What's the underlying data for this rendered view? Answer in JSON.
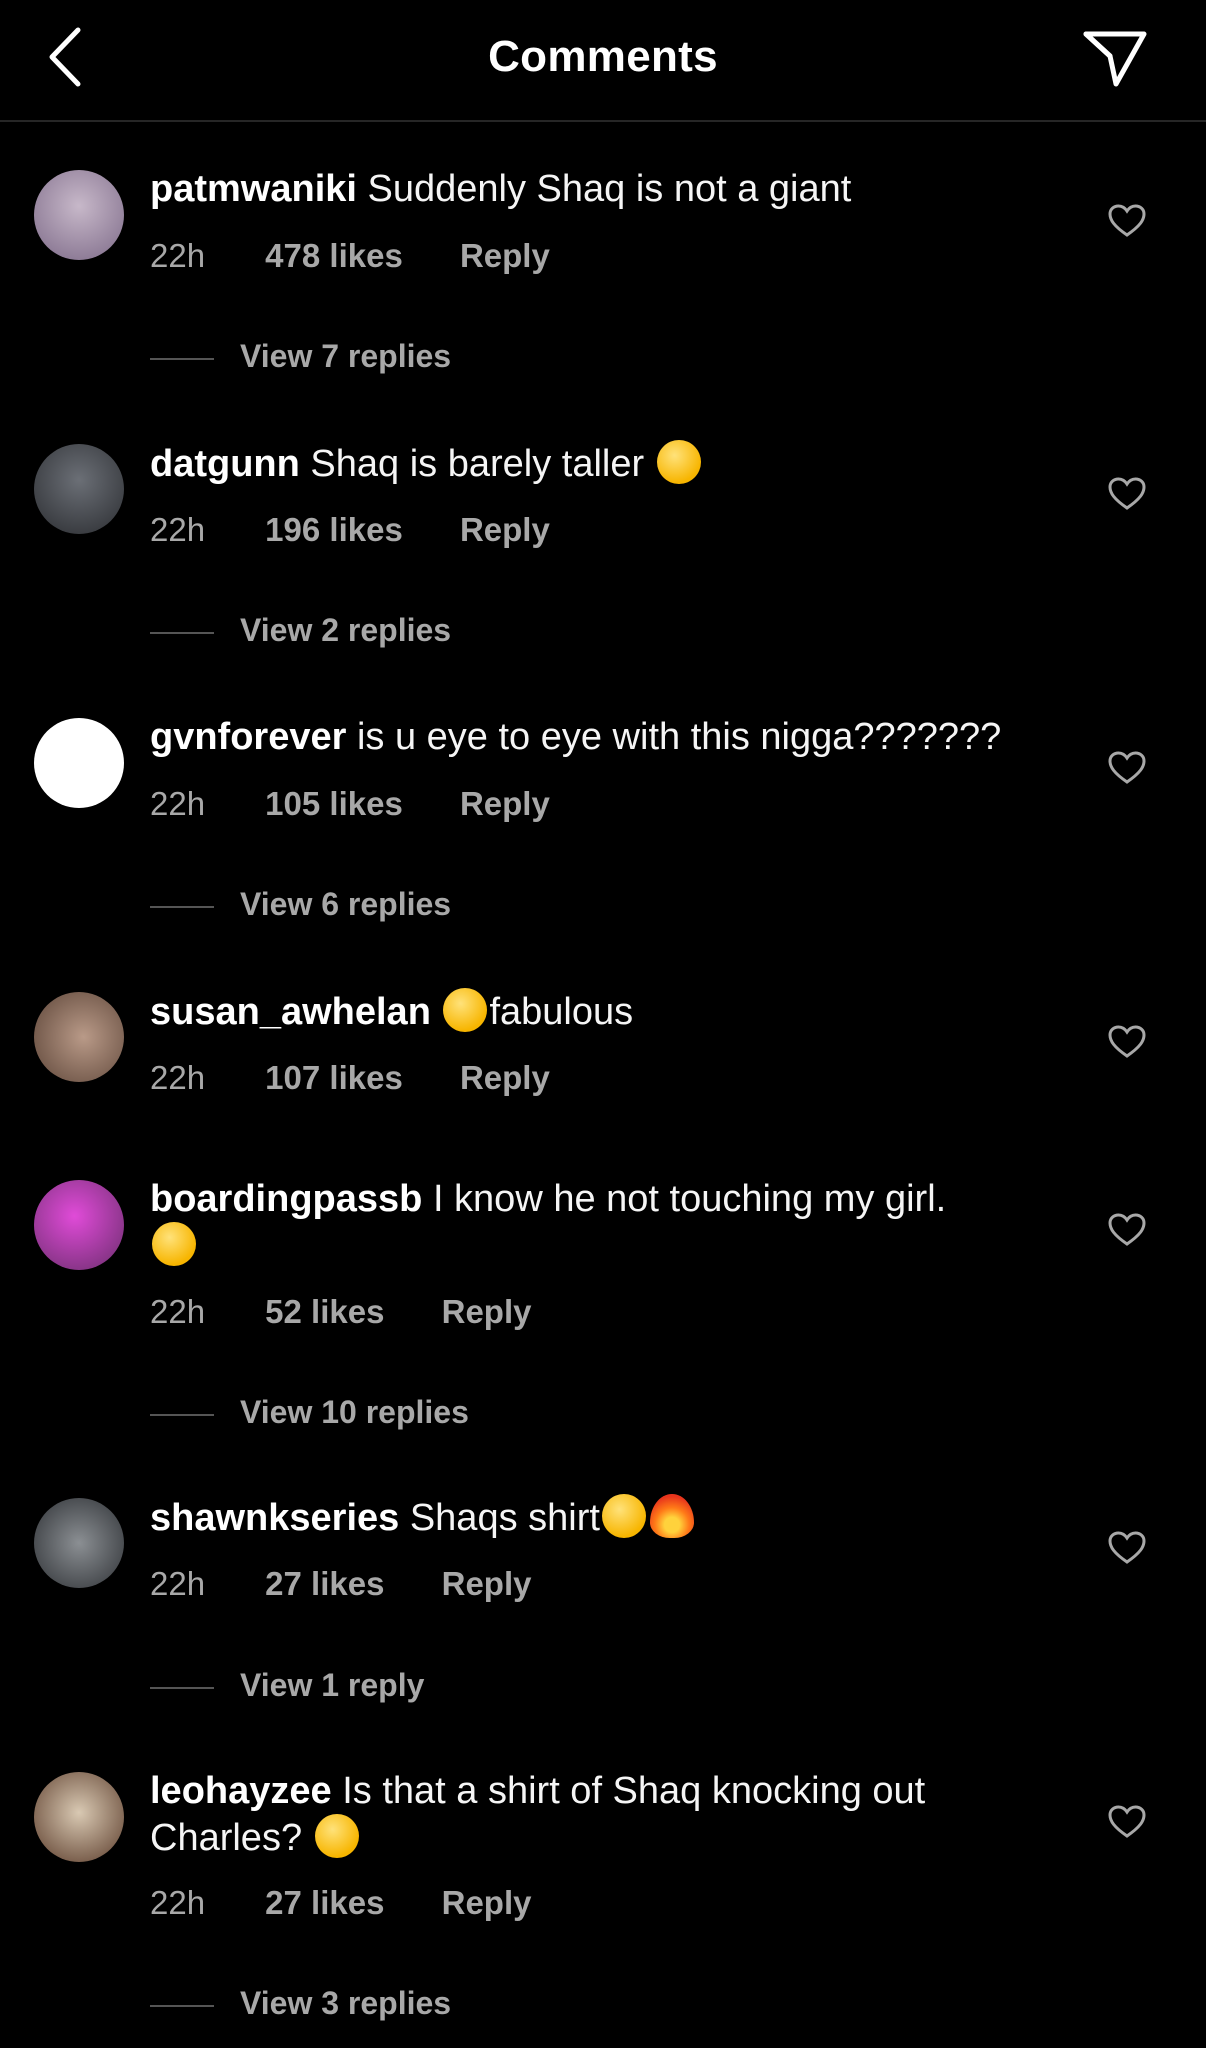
{
  "header": {
    "title": "Comments"
  },
  "comments": [
    {
      "username": "patmwaniki",
      "text": "Suddenly Shaq is not a giant",
      "emoji": [],
      "time": "22h",
      "likes": "478 likes",
      "reply": "Reply",
      "view_replies": "View 7 replies",
      "avatar_colors": [
        "#c7b8c9",
        "#7d6a88"
      ]
    },
    {
      "username": "datgunn",
      "text": "Shaq is barely taller",
      "emoji": [
        "astonished-face"
      ],
      "time": "22h",
      "likes": "196 likes",
      "reply": "Reply",
      "view_replies": "View 2 replies",
      "avatar_colors": [
        "#6b6f76",
        "#2b2d31"
      ]
    },
    {
      "username": "gvnforever",
      "text": "is u eye to eye with this nigga???????",
      "emoji": [],
      "time": "22h",
      "likes": "105 likes",
      "reply": "Reply",
      "view_replies": "View 6 replies",
      "avatar_colors": [
        "#ffffff",
        "#e9e9e9"
      ]
    },
    {
      "username": "susan_awhelan",
      "text": "fabulous",
      "emoji": [
        "pleading-face"
      ],
      "time": "22h",
      "likes": "107 likes",
      "reply": "Reply",
      "view_replies": "",
      "avatar_colors": [
        "#b99a88",
        "#5d4538"
      ]
    },
    {
      "username": "boardingpassb",
      "text": "I know he not touching my girl.",
      "emoji": [
        "tears-of-joy-face"
      ],
      "time": "22h",
      "likes": "52 likes",
      "reply": "Reply",
      "view_replies": "View 10 replies",
      "avatar_colors": [
        "#e04bd8",
        "#6a2d6c"
      ]
    },
    {
      "username": "shawnkseries",
      "text": "Shaqs shirt",
      "emoji": [
        "tears-of-joy-face",
        "fire"
      ],
      "time": "22h",
      "likes": "27 likes",
      "reply": "Reply",
      "view_replies": "View 1 reply",
      "avatar_colors": [
        "#8b8f93",
        "#2f3236"
      ]
    },
    {
      "username": "leohayzee",
      "text": "Is that a shirt of Shaq knocking out Charles?",
      "emoji": [
        "loudly-crying-face"
      ],
      "time": "22h",
      "likes": "27 likes",
      "reply": "Reply",
      "view_replies": "View 3 replies",
      "avatar_colors": [
        "#d9c9b3",
        "#5a3b2a"
      ]
    }
  ]
}
